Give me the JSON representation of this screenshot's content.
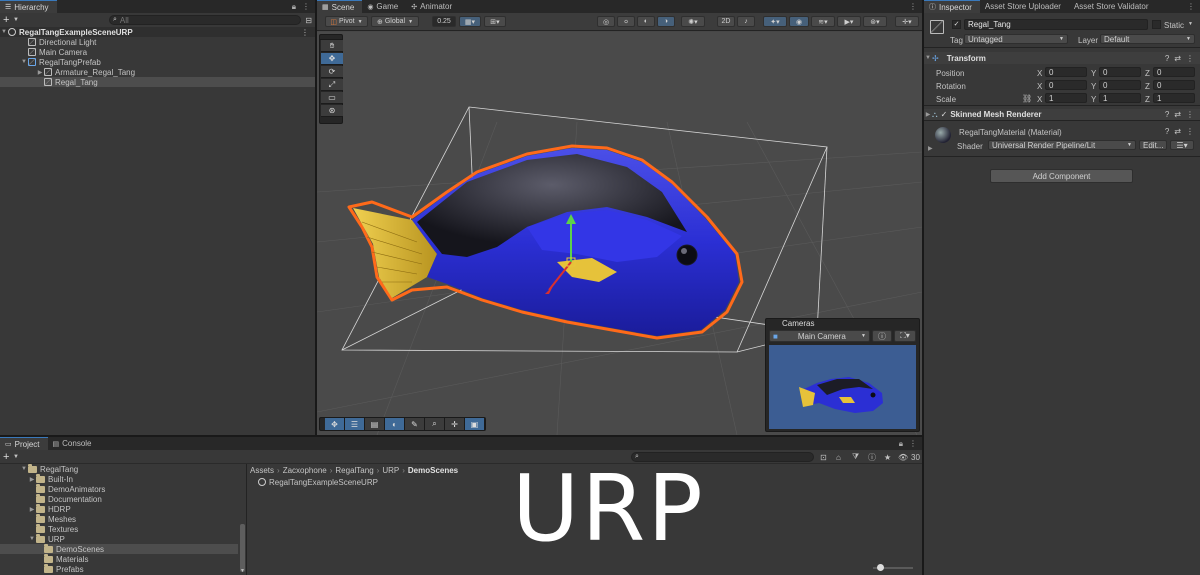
{
  "hierarchy": {
    "tab_label": "Hierarchy",
    "search_placeholder": "All",
    "add_label": "+",
    "items": [
      {
        "label": "RegalTangExampleSceneURP"
      },
      {
        "label": "Directional Light"
      },
      {
        "label": "Main Camera"
      },
      {
        "label": "RegalTangPrefab"
      },
      {
        "label": "Armature_Regal_Tang"
      },
      {
        "label": "Regal_Tang"
      }
    ]
  },
  "scene_view": {
    "tabs": [
      {
        "label": "Scene"
      },
      {
        "label": "Game"
      },
      {
        "label": "Animator"
      }
    ],
    "toolbar": {
      "pivot_label": "Pivot",
      "global_label": "Global",
      "snap_value": "0.25"
    },
    "cameras_overlay": {
      "title": "Cameras",
      "camera_select": "Main Camera"
    }
  },
  "inspector": {
    "tabs": [
      {
        "label": "Inspector"
      },
      {
        "label": "Asset Store Uploader"
      },
      {
        "label": "Asset Store Validator"
      }
    ],
    "object_name": "Regal_Tang",
    "static_label": "Static",
    "tag_label": "Tag",
    "tag_value": "Untagged",
    "layer_label": "Layer",
    "layer_value": "Default",
    "transform": {
      "title": "Transform",
      "position_label": "Position",
      "rotation_label": "Rotation",
      "scale_label": "Scale",
      "x": "X",
      "y": "Y",
      "z": "Z",
      "position": [
        "0",
        "0",
        "0"
      ],
      "rotation": [
        "0",
        "0",
        "0"
      ],
      "scale": [
        "1",
        "1",
        "1"
      ]
    },
    "skinned_mesh_renderer": {
      "title": "Skinned Mesh Renderer"
    },
    "material": {
      "name": "RegalTangMaterial (Material)",
      "shader_label": "Shader",
      "shader_value": "Universal Render Pipeline/Lit",
      "edit_label": "Edit..."
    },
    "add_component_label": "Add Component"
  },
  "project": {
    "tabs": [
      {
        "label": "Project"
      },
      {
        "label": "Console"
      }
    ],
    "add_label": "+",
    "count": "30",
    "tree": [
      {
        "label": "RegalTang"
      },
      {
        "label": "Built-In"
      },
      {
        "label": "DemoAnimators"
      },
      {
        "label": "Documentation"
      },
      {
        "label": "HDRP"
      },
      {
        "label": "Meshes"
      },
      {
        "label": "Textures"
      },
      {
        "label": "URP"
      },
      {
        "label": "DemoScenes"
      },
      {
        "label": "Materials"
      },
      {
        "label": "Prefabs"
      }
    ],
    "breadcrumb": [
      "Assets",
      "Zacxophone",
      "RegalTang",
      "URP",
      "DemoScenes"
    ],
    "breadcrumb_sep": "›",
    "files": [
      {
        "label": "RegalTangExampleSceneURP"
      }
    ]
  },
  "overlay_text": "URP",
  "colors": {
    "selection_outline": "#ff6a1a",
    "accent": "#3a79bb",
    "fish_blue": "#2b2fd4",
    "fish_yellow": "#e6c23a"
  }
}
